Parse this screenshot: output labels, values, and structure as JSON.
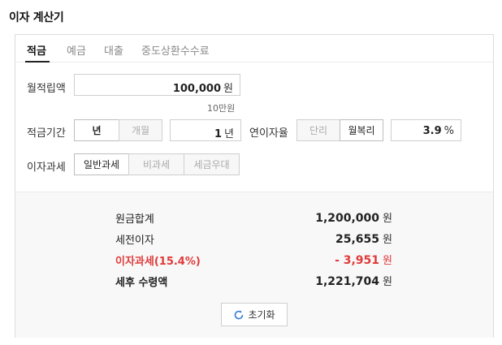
{
  "title": "이자 계산기",
  "tabs": [
    {
      "label": "적금",
      "active": true
    },
    {
      "label": "예금",
      "active": false
    },
    {
      "label": "대출",
      "active": false
    },
    {
      "label": "중도상환수수료",
      "active": false
    }
  ],
  "monthly_deposit": {
    "label": "월적립액",
    "value": "100,000",
    "unit": "원",
    "hint": "10만원"
  },
  "period": {
    "label": "적금기간",
    "options": [
      "년",
      "개월"
    ],
    "selected": "년",
    "value": "1",
    "unit": "년"
  },
  "rate": {
    "label": "연이자율",
    "options": [
      "단리",
      "월복리"
    ],
    "selected": "월복리",
    "value": "3.9",
    "unit": "%"
  },
  "tax": {
    "label": "이자과세",
    "options": [
      "일반과세",
      "비과세",
      "세금우대"
    ],
    "selected": "일반과세"
  },
  "results": [
    {
      "label": "원금합계",
      "value": "1,200,000",
      "unit": "원"
    },
    {
      "label": "세전이자",
      "value": "25,655",
      "unit": "원"
    },
    {
      "label": "이자과세(15.4%)",
      "value": "- 3,951",
      "unit": "원"
    },
    {
      "label": "세후 수령액",
      "value": "1,221,704",
      "unit": "원"
    }
  ],
  "reset_label": "초기화",
  "colors": {
    "accent_red": "#e03a3a",
    "refresh_icon": "#3b7dd8"
  },
  "icons": {
    "reset": "refresh-icon"
  }
}
